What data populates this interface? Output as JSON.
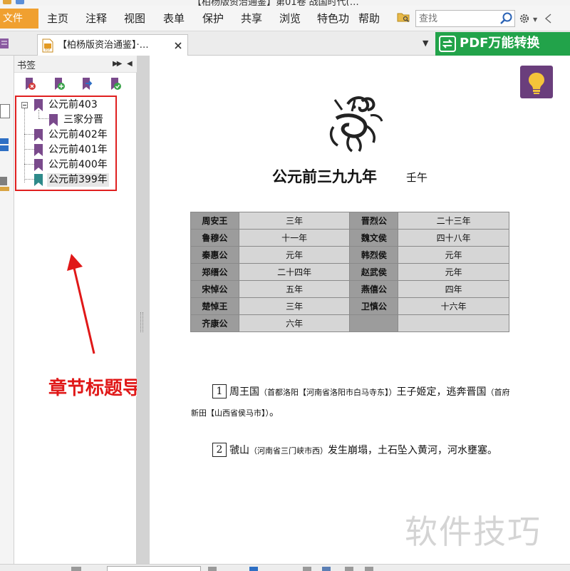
{
  "window": {
    "title": "【柏杨版资治通鉴】第01卷 战国时代(…"
  },
  "menu": {
    "file": "文件",
    "items": [
      "主页",
      "注释",
      "视图",
      "表单",
      "保护",
      "共享",
      "浏览",
      "特色功",
      "帮助"
    ]
  },
  "search": {
    "placeholder": "查找"
  },
  "tab": {
    "label": "【柏杨版资治通鉴】·…"
  },
  "convert": {
    "label": "PDF万能转换"
  },
  "bookmarks": {
    "title": "书签",
    "items": [
      {
        "label": "公元前403",
        "level": 0,
        "expanded": true
      },
      {
        "label": "三家分晋",
        "level": 1
      },
      {
        "label": "公元前402年",
        "level": 0
      },
      {
        "label": "公元前401年",
        "level": 0
      },
      {
        "label": "公元前400年",
        "level": 0
      },
      {
        "label": "公元前399年",
        "level": 0,
        "selected": true
      }
    ]
  },
  "annotation": {
    "label": "章节标题导航栏"
  },
  "document": {
    "title": "公元前三九九年",
    "subtitle": "壬午",
    "rulers": [
      [
        "周安王",
        "三年",
        "晋烈公",
        "二十三年"
      ],
      [
        "鲁穆公",
        "十一年",
        "魏文侯",
        "四十八年"
      ],
      [
        "秦惠公",
        "元年",
        "韩烈侯",
        "元年"
      ],
      [
        "郑缙公",
        "二十四年",
        "赵武侯",
        "元年"
      ],
      [
        "宋悼公",
        "五年",
        "燕僖公",
        "四年"
      ],
      [
        "楚悼王",
        "三年",
        "卫慎公",
        "十六年"
      ],
      [
        "齐康公",
        "六年",
        "",
        ""
      ]
    ],
    "para1": {
      "num": "1",
      "t1": "周王国",
      "n1": "（首都洛阳【河南省洛阳市白马寺东】）",
      "t2": "王子姬定，逃奔晋国",
      "n2": "（首府新田【山西省侯马市】）",
      "t3": "。"
    },
    "para2": {
      "num": "2",
      "t1": "虢山",
      "n1": "（河南省三门峡市西）",
      "t2": "发生崩塌，土石坠入黄河，河水壅塞。"
    }
  },
  "watermark": "软件技巧",
  "colors": {
    "file_menu": "#f0a030",
    "convert_button": "#22a34a",
    "bulb_button": "#6a3e7c",
    "annotation": "#e01818",
    "bookmark_flag": "#7a4a8c",
    "bookmark_flag_selected": "#2e8a8a"
  },
  "icons": {
    "search": "magnifier-icon",
    "settings": "gear-icon",
    "convert": "convert-icon",
    "bulb": "lightbulb-icon"
  }
}
